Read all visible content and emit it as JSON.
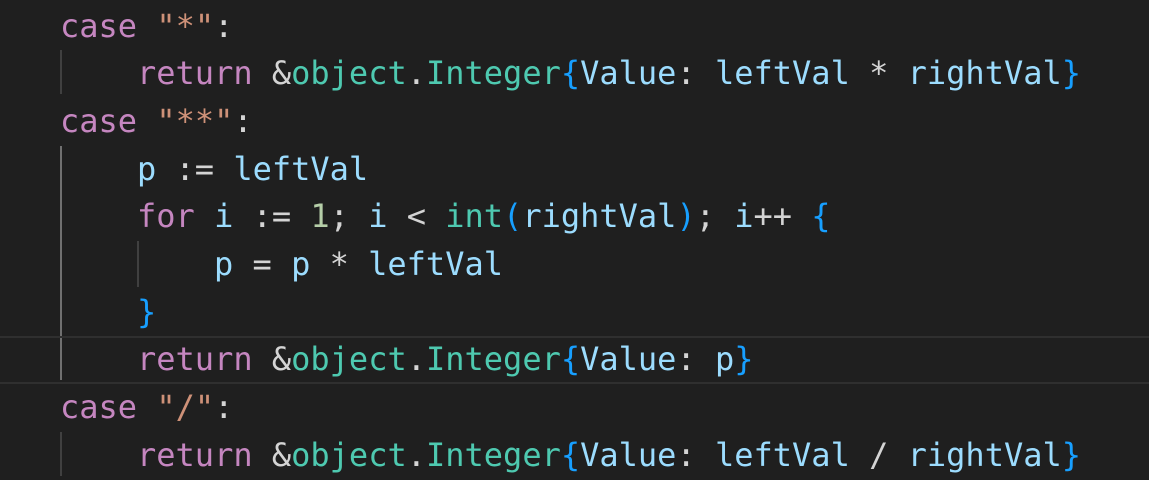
{
  "editor": {
    "language": "go",
    "lines": [
      {
        "tokens": [
          {
            "t": "case",
            "c": "kw-ctrl"
          },
          {
            "t": " ",
            "c": "op"
          },
          {
            "t": "\"*\"",
            "c": "str"
          },
          {
            "t": ":",
            "c": "op"
          }
        ]
      },
      {
        "tokens": [
          {
            "t": "return",
            "c": "kw-ctrl"
          },
          {
            "t": " &",
            "c": "op"
          },
          {
            "t": "object",
            "c": "type"
          },
          {
            "t": ".",
            "c": "op"
          },
          {
            "t": "Integer",
            "c": "type"
          },
          {
            "t": "{",
            "c": "br1"
          },
          {
            "t": "Value",
            "c": "var"
          },
          {
            "t": ": ",
            "c": "op"
          },
          {
            "t": "leftVal",
            "c": "var"
          },
          {
            "t": " * ",
            "c": "op"
          },
          {
            "t": "rightVal",
            "c": "var"
          },
          {
            "t": "}",
            "c": "br1"
          }
        ]
      },
      {
        "tokens": [
          {
            "t": "case",
            "c": "kw-ctrl"
          },
          {
            "t": " ",
            "c": "op"
          },
          {
            "t": "\"**\"",
            "c": "str"
          },
          {
            "t": ":",
            "c": "op"
          }
        ]
      },
      {
        "tokens": [
          {
            "t": "p",
            "c": "var"
          },
          {
            "t": " := ",
            "c": "op"
          },
          {
            "t": "leftVal",
            "c": "var"
          }
        ]
      },
      {
        "tokens": [
          {
            "t": "for",
            "c": "kw-ctrl"
          },
          {
            "t": " ",
            "c": "op"
          },
          {
            "t": "i",
            "c": "var"
          },
          {
            "t": " := ",
            "c": "op"
          },
          {
            "t": "1",
            "c": "num"
          },
          {
            "t": "; ",
            "c": "op"
          },
          {
            "t": "i",
            "c": "var"
          },
          {
            "t": " < ",
            "c": "op"
          },
          {
            "t": "int",
            "c": "type"
          },
          {
            "t": "(",
            "c": "br1"
          },
          {
            "t": "rightVal",
            "c": "var"
          },
          {
            "t": ")",
            "c": "br1"
          },
          {
            "t": "; ",
            "c": "op"
          },
          {
            "t": "i",
            "c": "var"
          },
          {
            "t": "++ ",
            "c": "op"
          },
          {
            "t": "{",
            "c": "br1"
          }
        ]
      },
      {
        "tokens": [
          {
            "t": "p",
            "c": "var"
          },
          {
            "t": " = ",
            "c": "op"
          },
          {
            "t": "p",
            "c": "var"
          },
          {
            "t": " * ",
            "c": "op"
          },
          {
            "t": "leftVal",
            "c": "var"
          }
        ]
      },
      {
        "tokens": [
          {
            "t": "}",
            "c": "br1"
          }
        ]
      },
      {
        "tokens": [
          {
            "t": "return",
            "c": "kw-ctrl"
          },
          {
            "t": " &",
            "c": "op"
          },
          {
            "t": "object",
            "c": "type"
          },
          {
            "t": ".",
            "c": "op"
          },
          {
            "t": "Integer",
            "c": "type"
          },
          {
            "t": "{",
            "c": "br1"
          },
          {
            "t": "Value",
            "c": "var"
          },
          {
            "t": ": ",
            "c": "op"
          },
          {
            "t": "p",
            "c": "var"
          },
          {
            "t": "}",
            "c": "br1"
          }
        ]
      },
      {
        "tokens": [
          {
            "t": "case",
            "c": "kw-ctrl"
          },
          {
            "t": " ",
            "c": "op"
          },
          {
            "t": "\"/\"",
            "c": "str"
          },
          {
            "t": ":",
            "c": "op"
          }
        ]
      },
      {
        "tokens": [
          {
            "t": "return",
            "c": "kw-ctrl"
          },
          {
            "t": " &",
            "c": "op"
          },
          {
            "t": "object",
            "c": "type"
          },
          {
            "t": ".",
            "c": "op"
          },
          {
            "t": "Integer",
            "c": "type"
          },
          {
            "t": "{",
            "c": "br1"
          },
          {
            "t": "Value",
            "c": "var"
          },
          {
            "t": ": ",
            "c": "op"
          },
          {
            "t": "leftVal",
            "c": "var"
          },
          {
            "t": " / ",
            "c": "op"
          },
          {
            "t": "rightVal",
            "c": "var"
          },
          {
            "t": "}",
            "c": "br1"
          }
        ]
      }
    ]
  },
  "colors": {
    "background": "#1f1f1f",
    "keyword": "#c586c0",
    "string": "#ce9178",
    "number": "#b5cea8",
    "variable": "#9cdcfe",
    "type": "#4ec9b0",
    "bracket": "#179fff"
  }
}
